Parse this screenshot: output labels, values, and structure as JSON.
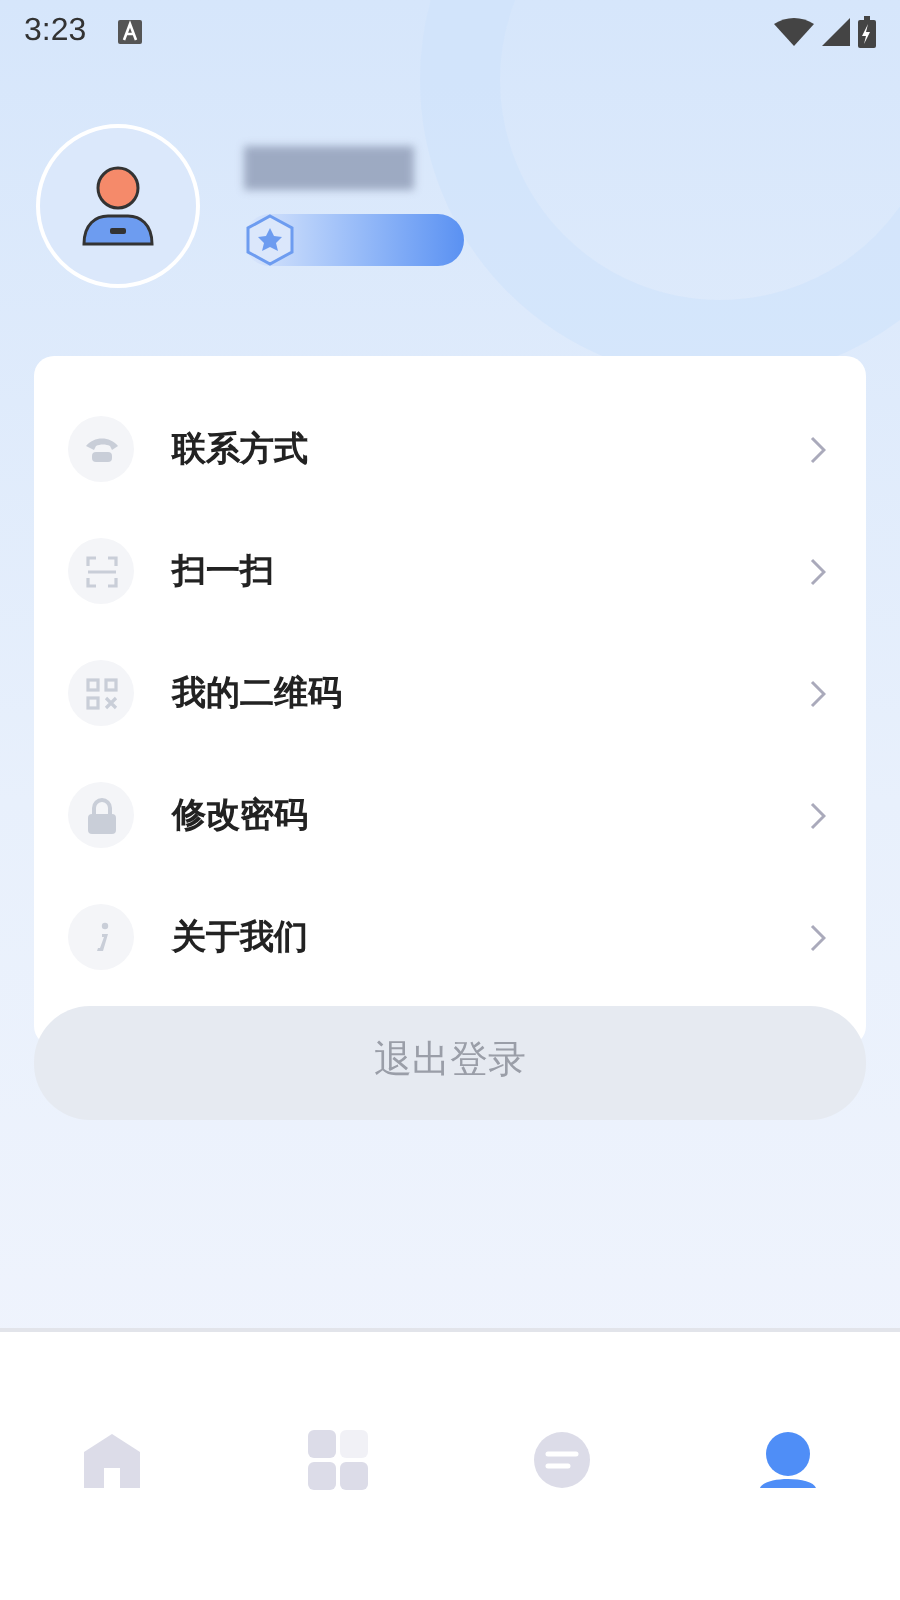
{
  "status_bar": {
    "time": "3:23"
  },
  "menu": [
    {
      "kind": "phone",
      "label": "联系方式"
    },
    {
      "kind": "scan",
      "label": "扫一扫"
    },
    {
      "kind": "qr",
      "label": "我的二维码"
    },
    {
      "kind": "lock",
      "label": "修改密码"
    },
    {
      "kind": "info",
      "label": "关于我们"
    }
  ],
  "logout_button": {
    "label": "退出登录",
    "disabled": true
  },
  "tab_bar": [
    {
      "kind": "home",
      "selected": false
    },
    {
      "kind": "apps",
      "selected": false
    },
    {
      "kind": "chat",
      "selected": false
    },
    {
      "kind": "profile",
      "selected": true
    }
  ]
}
